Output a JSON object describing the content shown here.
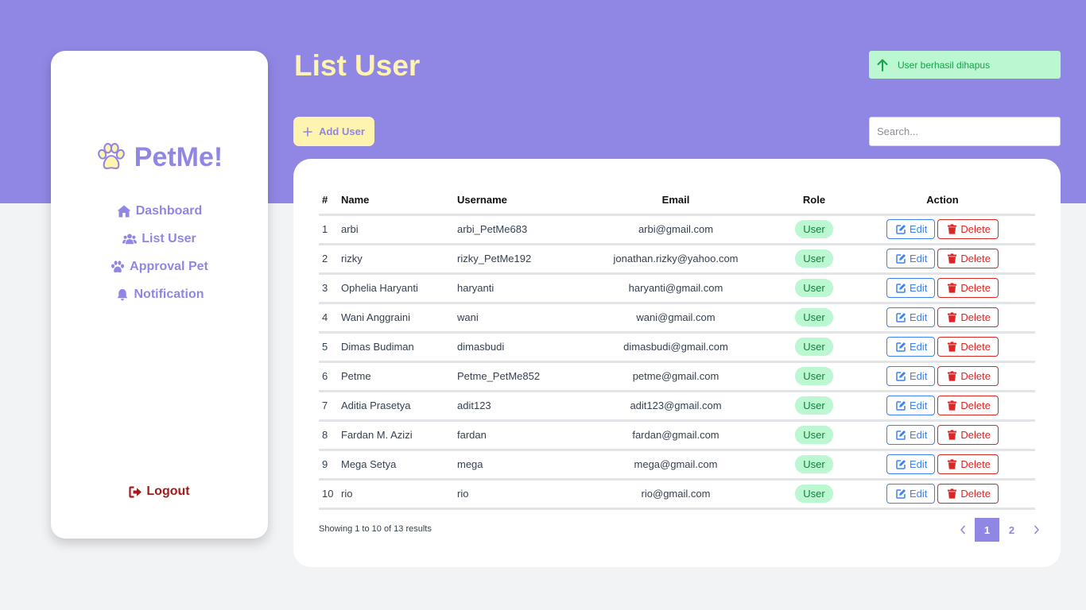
{
  "app": {
    "brand": "PetMe!"
  },
  "sidebar": {
    "items": [
      {
        "label": "Dashboard",
        "icon": "home-icon"
      },
      {
        "label": "List User",
        "icon": "users-icon"
      },
      {
        "label": "Approval Pet",
        "icon": "paw-icon"
      },
      {
        "label": "Notification",
        "icon": "bell-icon"
      }
    ],
    "logout_label": "Logout"
  },
  "header": {
    "title": "List User",
    "add_button_label": "Add User",
    "search_placeholder": "Search...",
    "toast_message": "User berhasil dihapus"
  },
  "table": {
    "columns": [
      "#",
      "Name",
      "Username",
      "Email",
      "Role",
      "Action"
    ],
    "edit_label": "Edit",
    "delete_label": "Delete",
    "rows": [
      {
        "no": "1",
        "name": "arbi",
        "username": "arbi_PetMe683",
        "email": "arbi@gmail.com",
        "role": "User"
      },
      {
        "no": "2",
        "name": "rizky",
        "username": "rizky_PetMe192",
        "email": "jonathan.rizky@yahoo.com",
        "role": "User"
      },
      {
        "no": "3",
        "name": "Ophelia Haryanti",
        "username": "haryanti",
        "email": "haryanti@gmail.com",
        "role": "User"
      },
      {
        "no": "4",
        "name": "Wani Anggraini",
        "username": "wani",
        "email": "wani@gmail.com",
        "role": "User"
      },
      {
        "no": "5",
        "name": "Dimas Budiman",
        "username": "dimasbudi",
        "email": "dimasbudi@gmail.com",
        "role": "User"
      },
      {
        "no": "6",
        "name": "Petme",
        "username": "Petme_PetMe852",
        "email": "petme@gmail.com",
        "role": "User"
      },
      {
        "no": "7",
        "name": "Aditia Prasetya",
        "username": "adit123",
        "email": "adit123@gmail.com",
        "role": "User"
      },
      {
        "no": "8",
        "name": "Fardan M. Azizi",
        "username": "fardan",
        "email": "fardan@gmail.com",
        "role": "User"
      },
      {
        "no": "9",
        "name": "Mega Setya",
        "username": "mega",
        "email": "mega@gmail.com",
        "role": "User"
      },
      {
        "no": "10",
        "name": "rio",
        "username": "rio",
        "email": "rio@gmail.com",
        "role": "User"
      }
    ]
  },
  "pagination": {
    "summary": "Showing 1 to 10 of 13 results",
    "pages": [
      "1",
      "2"
    ],
    "active_page": "1"
  },
  "colors": {
    "primary": "#8f87e3",
    "accent_yellow": "#fff3b0",
    "success_bg": "#bbf7d0",
    "success_text": "#16a34a",
    "edit_blue": "#3b82f6",
    "delete_red": "#dc2626",
    "logout_red": "#a21c1c"
  }
}
